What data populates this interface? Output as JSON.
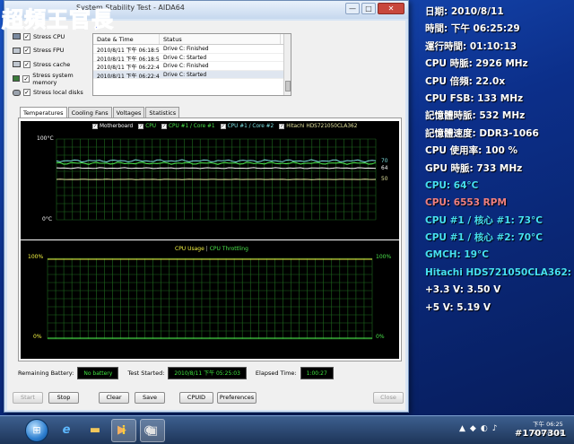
{
  "watermark": "超頻王官長",
  "window": {
    "title": "System Stability Test - AIDA64",
    "controls": {
      "minimize": "—",
      "maximize": "□",
      "close": "✕"
    }
  },
  "stress_options": [
    {
      "label": "Stress CPU",
      "checked": true,
      "icon": "cpu-icon"
    },
    {
      "label": "Stress FPU",
      "checked": true,
      "icon": "fpu-icon"
    },
    {
      "label": "Stress cache",
      "checked": true,
      "icon": "cache-icon"
    },
    {
      "label": "Stress system memory",
      "checked": true,
      "icon": "memory-icon"
    },
    {
      "label": "Stress local disks",
      "checked": true,
      "icon": "disk-icon"
    }
  ],
  "log": {
    "headers": {
      "date": "Date & Time",
      "status": "Status"
    },
    "rows": [
      {
        "date": "2010/8/11 下午 06:18:52",
        "status": "Drive C: Finished"
      },
      {
        "date": "2010/8/11 下午 06:18:52",
        "status": "Drive C: Started"
      },
      {
        "date": "2010/8/11 下午 06:22:42",
        "status": "Drive C: Finished"
      },
      {
        "date": "2010/8/11 下午 06:22:42",
        "status": "Drive C: Started"
      }
    ]
  },
  "tabs": [
    "Temperatures",
    "Cooling Fans",
    "Voltages",
    "Statistics"
  ],
  "active_tab": "Temperatures",
  "temp_chart": {
    "legend": [
      "Motherboard",
      "CPU",
      "CPU #1 / Core #1",
      "CPU #1 / Core #2",
      "Hitachi HDS721050CLA362"
    ],
    "y_top": "100°C",
    "y_bottom": "0°C",
    "value_labels": [
      "70",
      "64",
      "50"
    ],
    "colors": {
      "motherboard": "#ffffff",
      "cpu": "#4be34b",
      "core1": "#4be34b",
      "core2": "#7de0e0",
      "hdd": "#e6e6a0"
    }
  },
  "usage_chart": {
    "legend_usage": "CPU Usage",
    "legend_sep": "|",
    "legend_throttle": "CPU Throttling",
    "y_top_left": "100%",
    "y_bottom_left": "0%",
    "y_top_right": "100%",
    "y_bottom_right": "0%",
    "colors": {
      "usage": "#f5f542",
      "throttle": "#4be34b"
    }
  },
  "status": {
    "battery_label": "Remaining Battery:",
    "battery_value": "No battery",
    "started_label": "Test Started:",
    "started_value": "2010/8/11 下午 05:25:03",
    "elapsed_label": "Elapsed Time:",
    "elapsed_value": "1:00:27"
  },
  "buttons": {
    "start": "Start",
    "stop": "Stop",
    "clear": "Clear",
    "save": "Save",
    "cpuid": "CPUID",
    "preferences": "Preferences",
    "close": "Close"
  },
  "overlay": [
    {
      "text": "日期: 2010/8/11",
      "color": "#ffffff"
    },
    {
      "text": "時間: 下午 06:25:29",
      "color": "#ffffff"
    },
    {
      "text": "運行時間: 01:10:13",
      "color": "#ffffff"
    },
    {
      "text": "CPU 時脈: 2926 MHz",
      "color": "#ffffff"
    },
    {
      "text": "CPU 倍頻: 22.0x",
      "color": "#ffffff"
    },
    {
      "text": "CPU FSB: 133 MHz",
      "color": "#ffffff"
    },
    {
      "text": "記憶體時脈: 532 MHz",
      "color": "#ffffff"
    },
    {
      "text": "記憶體速度: DDR3-1066",
      "color": "#ffffff"
    },
    {
      "text": "CPU 使用率: 100 %",
      "color": "#ffffff"
    },
    {
      "text": "GPU 時脈: 733 MHz",
      "color": "#ffffff"
    },
    {
      "text": "CPU: 64°C",
      "color": "#46e0f0"
    },
    {
      "text": "CPU: 6553 RPM",
      "color": "#f08080"
    },
    {
      "text": "CPU #1 / 核心 #1: 73°C",
      "color": "#46e0f0"
    },
    {
      "text": "CPU #1 / 核心 #2: 70°C",
      "color": "#46e0f0"
    },
    {
      "text": "GMCH: 19°C",
      "color": "#46e0f0"
    },
    {
      "text": "Hitachi HDS721050CLA362: 50°C",
      "color": "#46e0f0"
    },
    {
      "text": "+3.3 V: 3.50 V",
      "color": "#ffffff"
    },
    {
      "text": "+5 V: 5.19 V",
      "color": "#ffffff"
    }
  ],
  "taskbar": {
    "start_glyph": "⊞",
    "apps": [
      {
        "name": "internet-explorer-icon",
        "glyph": "e"
      },
      {
        "name": "explorer-folder-icon",
        "glyph": "▬"
      },
      {
        "name": "media-player-icon",
        "glyph": "▶"
      },
      {
        "name": "app-icon",
        "glyph": "◉"
      },
      {
        "name": "info-app-icon",
        "glyph": "i"
      },
      {
        "name": "aida64-icon",
        "glyph": "▣"
      }
    ],
    "tray": [
      "▲",
      "◆",
      "◐",
      "♪"
    ],
    "clock_line1": "下午 06:25",
    "clock_line2": "2010/8/11"
  },
  "corner_tag": "#1707301"
}
